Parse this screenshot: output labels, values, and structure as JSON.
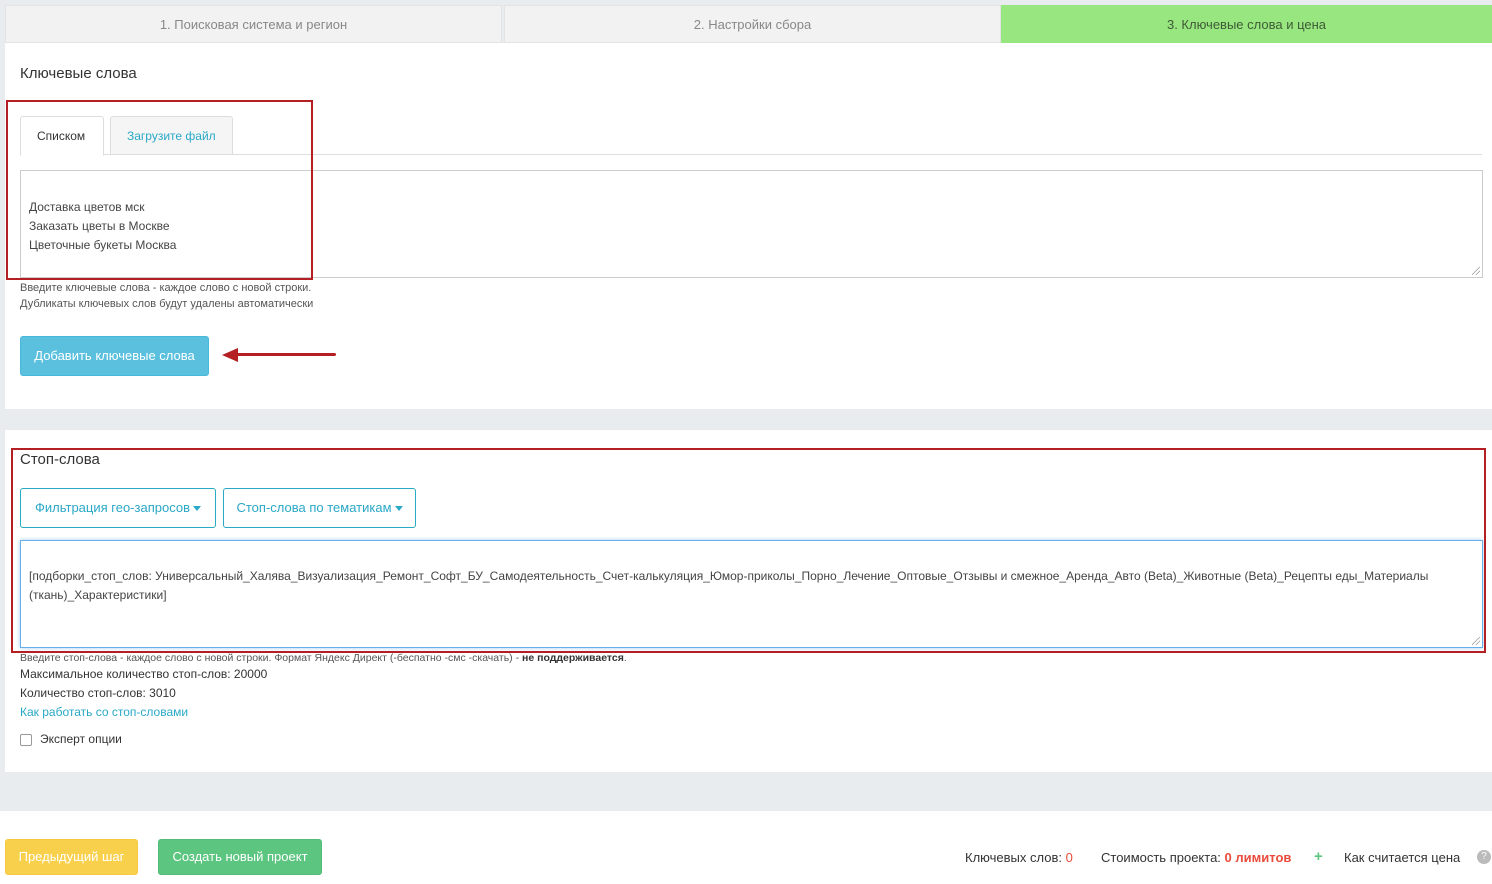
{
  "steps": [
    {
      "label": "1. Поисковая система и регион"
    },
    {
      "label": "2. Настройки сбора"
    },
    {
      "label": "3. Ключевые слова и цена"
    }
  ],
  "keywords": {
    "title": "Ключевые слова",
    "tabs": [
      {
        "label": "Списком"
      },
      {
        "label": "Загрузите файл"
      }
    ],
    "textarea_value": "Доставка цветов мск\nЗаказать цветы в Москве\nЦветочные букеты Москва",
    "hint_line1": "Введите ключевые слова - каждое слово с новой строки.",
    "hint_line2": "Дубликаты ключевых слов будут удалены автоматически",
    "add_button": "Добавить ключевые слова"
  },
  "stopwords": {
    "title": "Стоп-слова",
    "geo_filter_button": "Фильтрация гео-запросов",
    "topics_button": "Стоп-слова по тематикам",
    "textarea_value": "[подборки_стоп_слов: Универсальный_Халява_Визуализация_Ремонт_Софт_БУ_Самодеятельность_Счет-калькуляция_Юмор-приколы_Порно_Лечение_Оптовые_Отзывы и смежное_Аренда_Авто (Beta)_Животные (Beta)_Рецепты еды_Материалы (ткань)_Характеристики]",
    "hint_main": "Введите стоп-слова - каждое слово с новой строки. Формат Яндекс Директ (-беспатно -смс -скачать) - ",
    "hint_bold": "не поддерживается",
    "hint_end": ".",
    "max_count": "Максимальное количество стоп-слов: 20000",
    "count": "Количество стоп-слов: 3010",
    "how_to_link": "Как работать со стоп-словами",
    "expert_label": "Эксперт опции"
  },
  "footer": {
    "prev_button": "Предыдущий шаг",
    "create_button": "Создать новый проект",
    "keywords_label": "Ключевых слов:",
    "keywords_value": "0",
    "cost_label": "Стоимость проекта:",
    "cost_value": "0 лимитов",
    "plus": "+",
    "how_price": "Как считается цена",
    "help_icon": "?"
  },
  "colors": {
    "active_step": "#98e680",
    "accent": "#2aa8c7",
    "annotation": "#b31f23"
  }
}
